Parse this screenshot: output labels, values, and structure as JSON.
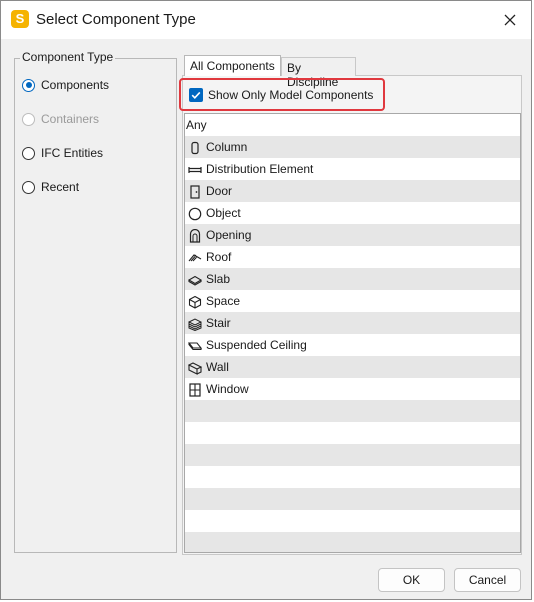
{
  "window": {
    "title": "Select Component Type",
    "app_icon_letter": "S"
  },
  "group": {
    "legend": "Component Type",
    "options": [
      {
        "label": "Components",
        "state": "checked"
      },
      {
        "label": "Containers",
        "state": "disabled"
      },
      {
        "label": "IFC Entities",
        "state": "unchecked"
      },
      {
        "label": "Recent",
        "state": "unchecked"
      }
    ]
  },
  "tabs": {
    "all": "All Components",
    "discipline": "By Discipline"
  },
  "filter": {
    "label": "Show Only Model Components",
    "checked": true
  },
  "list": {
    "items": [
      {
        "label": "Any",
        "icon": ""
      },
      {
        "label": "Column",
        "icon": "column-icon"
      },
      {
        "label": "Distribution Element",
        "icon": "distribution-element-icon"
      },
      {
        "label": "Door",
        "icon": "door-icon"
      },
      {
        "label": "Object",
        "icon": "object-icon"
      },
      {
        "label": "Opening",
        "icon": "opening-icon"
      },
      {
        "label": "Roof",
        "icon": "roof-icon"
      },
      {
        "label": "Slab",
        "icon": "slab-icon"
      },
      {
        "label": "Space",
        "icon": "space-icon"
      },
      {
        "label": "Stair",
        "icon": "stair-icon"
      },
      {
        "label": "Suspended Ceiling",
        "icon": "suspended-ceiling-icon"
      },
      {
        "label": "Wall",
        "icon": "wall-icon"
      },
      {
        "label": "Window",
        "icon": "window-icon"
      }
    ]
  },
  "buttons": {
    "ok": "OK",
    "cancel": "Cancel"
  },
  "colors": {
    "accent": "#0067c0",
    "highlight": "#e0383e",
    "app_icon": "#f5b301"
  }
}
